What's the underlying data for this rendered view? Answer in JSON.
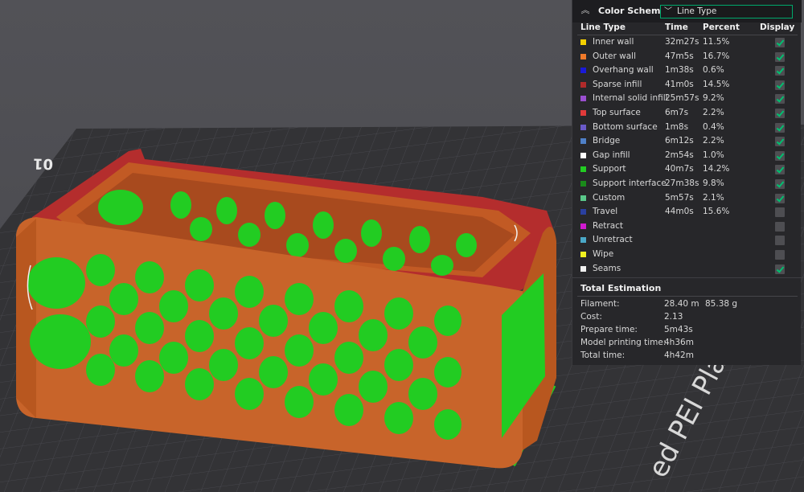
{
  "color_scheme": {
    "label": "Color Scheme",
    "selected": "Line Type"
  },
  "columns": {
    "type": "Line Type",
    "time": "Time",
    "percent": "Percent",
    "display": "Display"
  },
  "line_types": [
    {
      "label": "Inner wall",
      "time": "32m27s",
      "percent": "11.5%",
      "color": "#f5d000",
      "display": true
    },
    {
      "label": "Outer wall",
      "time": "47m5s",
      "percent": "16.7%",
      "color": "#f07a2a",
      "display": true
    },
    {
      "label": "Overhang wall",
      "time": "1m38s",
      "percent": "0.6%",
      "color": "#1a1ad8",
      "display": true
    },
    {
      "label": "Sparse infill",
      "time": "41m0s",
      "percent": "14.5%",
      "color": "#b02a2a",
      "display": true
    },
    {
      "label": "Internal solid infill",
      "time": "25m57s",
      "percent": "9.2%",
      "color": "#9a4fd0",
      "display": true
    },
    {
      "label": "Top surface",
      "time": "6m7s",
      "percent": "2.2%",
      "color": "#e03a3a",
      "display": true
    },
    {
      "label": "Bottom surface",
      "time": "1m8s",
      "percent": "0.4%",
      "color": "#6a5ac8",
      "display": true
    },
    {
      "label": "Bridge",
      "time": "6m12s",
      "percent": "2.2%",
      "color": "#4f80c8",
      "display": true
    },
    {
      "label": "Gap infill",
      "time": "2m54s",
      "percent": "1.0%",
      "color": "#ffffff",
      "display": true
    },
    {
      "label": "Support",
      "time": "40m7s",
      "percent": "14.2%",
      "color": "#22cc22",
      "display": true
    },
    {
      "label": "Support interface",
      "time": "27m38s",
      "percent": "9.8%",
      "color": "#1a8a1a",
      "display": true
    },
    {
      "label": "Custom",
      "time": "5m57s",
      "percent": "2.1%",
      "color": "#5ac88a",
      "display": true
    },
    {
      "label": "Travel",
      "time": "44m0s",
      "percent": "15.6%",
      "color": "#2a40a0",
      "display": false
    },
    {
      "label": "Retract",
      "time": "",
      "percent": "",
      "color": "#d01ad0",
      "display": false
    },
    {
      "label": "Unretract",
      "time": "",
      "percent": "",
      "color": "#4aa8c8",
      "display": false
    },
    {
      "label": "Wipe",
      "time": "",
      "percent": "",
      "color": "#f0f020",
      "display": false
    },
    {
      "label": "Seams",
      "time": "",
      "percent": "",
      "color": "#f0f0f0",
      "display": true
    }
  ],
  "total": {
    "title": "Total Estimation",
    "rows": [
      {
        "label": "Filament:",
        "value": "28.40 m",
        "value2": "85.38 g"
      },
      {
        "label": "Cost:",
        "value": "2.13",
        "value2": ""
      },
      {
        "label": "Prepare time:",
        "value": "5m43s",
        "value2": ""
      },
      {
        "label": "Model printing time:",
        "value": "4h36m",
        "value2": ""
      },
      {
        "label": "Total time:",
        "value": "4h42m",
        "value2": ""
      }
    ]
  },
  "plate": {
    "number": "01",
    "name": "ed PEI Plate"
  },
  "icons": {
    "collapse": "chevron-up-icon",
    "dropdown": "chevron-down-icon",
    "check": "checkmark-icon"
  },
  "colors": {
    "accent": "#00a86b",
    "model_outer": "#c8642a",
    "model_top": "#b42d2d",
    "support": "#22cc22"
  }
}
